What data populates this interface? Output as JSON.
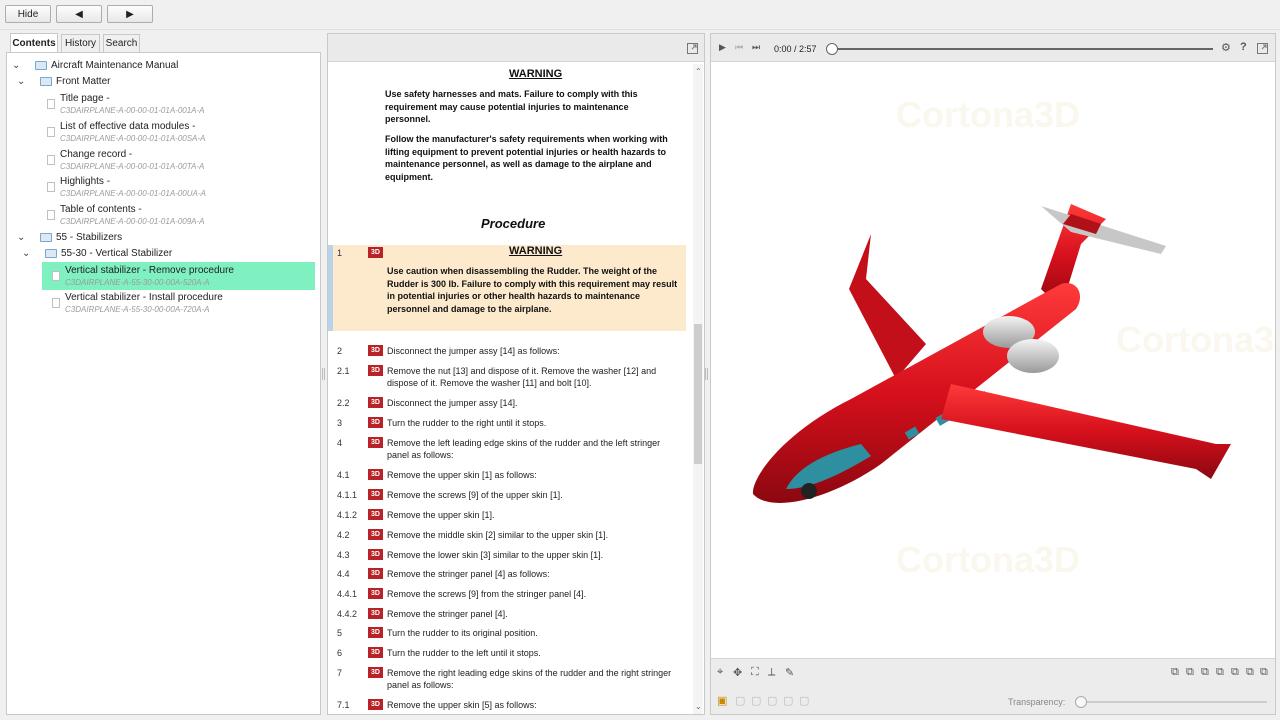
{
  "toolbar": {
    "hide_label": "Hide",
    "prev_glyph": "◀",
    "next_glyph": "▶"
  },
  "tabs": [
    "Contents",
    "History",
    "Search"
  ],
  "tree": {
    "root": "Aircraft Maintenance Manual",
    "front_matter": "Front Matter",
    "items": [
      {
        "title": "Title page -",
        "code": "C3DAIRPLANE-A-00-00-01-01A-001A-A"
      },
      {
        "title": "List of effective data modules -",
        "code": "C3DAIRPLANE-A-00-00-01-01A-00SA-A"
      },
      {
        "title": "Change record -",
        "code": "C3DAIRPLANE-A-00-00-01-01A-00TA-A"
      },
      {
        "title": "Highlights -",
        "code": "C3DAIRPLANE-A-00-00-01-01A-00UA-A"
      },
      {
        "title": "Table of contents -",
        "code": "C3DAIRPLANE-A-00-00-01-01A-009A-A"
      }
    ],
    "chapter": "55 - Stabilizers",
    "section": "55-30 - Vertical Stabilizer",
    "procedures": [
      {
        "title": "Vertical stabilizer - Remove procedure",
        "code": "C3DAIRPLANE-A-55-30-00-00A-520A-A"
      },
      {
        "title": "Vertical stabilizer - Install procedure",
        "code": "C3DAIRPLANE-A-55-30-00-00A-720A-A"
      }
    ]
  },
  "doc": {
    "warning_label": "WARNING",
    "warn1": "Use safety harnesses and mats. Failure to comply with this requirement may cause potential injuries to maintenance personnel.",
    "warn2": "Follow the manufacturer's safety requirements when working with lifting equipment to prevent potential injuries or health hazards to maintenance personnel, as well as damage to the airplane and equipment.",
    "procedure_title": "Procedure",
    "step1_warning": "Use caution when disassembling the Rudder. The weight of the Rudder is 300 lb. Failure to comply with this requirement may result in potential injuries or other health hazards to maintenance personnel and damage to the airplane.",
    "badge": "3D",
    "steps": [
      {
        "num": "1",
        "text": ""
      },
      {
        "num": "2",
        "text": "Disconnect the jumper assy [14] as follows:"
      },
      {
        "num": "2.1",
        "text": "Remove the nut [13] and dispose of it. Remove the washer [12] and dispose of it. Remove the washer [11] and bolt [10]."
      },
      {
        "num": "2.2",
        "text": "Disconnect the jumper assy [14]."
      },
      {
        "num": "3",
        "text": "Turn the rudder to the right until it stops."
      },
      {
        "num": "4",
        "text": "Remove the left leading edge skins of the rudder and the left stringer panel as follows:"
      },
      {
        "num": "4.1",
        "text": "Remove the upper skin [1] as follows:"
      },
      {
        "num": "4.1.1",
        "text": "Remove the screws [9] of the upper skin [1]."
      },
      {
        "num": "4.1.2",
        "text": "Remove the upper skin [1]."
      },
      {
        "num": "4.2",
        "text": "Remove the middle skin [2] similar to the upper skin [1]."
      },
      {
        "num": "4.3",
        "text": "Remove the lower skin [3] similar to the upper skin [1]."
      },
      {
        "num": "4.4",
        "text": "Remove the stringer panel [4] as follows:"
      },
      {
        "num": "4.4.1",
        "text": "Remove the screws [9] from the stringer panel [4]."
      },
      {
        "num": "4.4.2",
        "text": "Remove the stringer panel [4]."
      },
      {
        "num": "5",
        "text": "Turn the rudder to its original position."
      },
      {
        "num": "6",
        "text": "Turn the rudder to the left until it stops."
      },
      {
        "num": "7",
        "text": "Remove the right leading edge skins of the rudder and the right stringer panel as follows:"
      },
      {
        "num": "7.1",
        "text": "Remove the upper skin [5] as follows:"
      }
    ]
  },
  "viewer": {
    "time": "0:00 / 2:57",
    "progress": 0,
    "watermark": "Cortona3D",
    "transparency_label": "Transparency:",
    "transparency_value": 0
  },
  "colors": {
    "selected": "#7ff0c0",
    "badge": "#b92226",
    "warning_band": "#fde9cc",
    "airplane": "#d6101c"
  }
}
